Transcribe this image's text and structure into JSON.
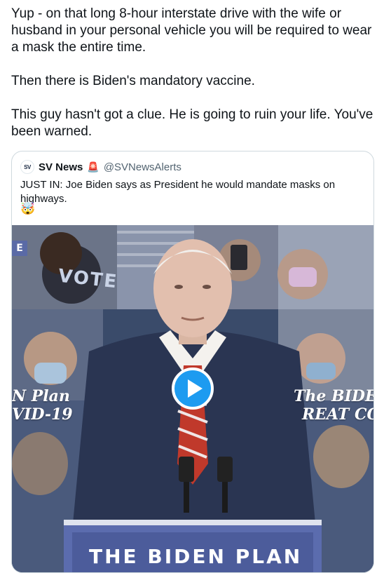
{
  "tweet": {
    "paragraphs": [
      "Yup - on that long 8-hour interstate drive with the wife or husband in your personal vehicle you will be required to wear a mask the entire time.",
      "Then there is Biden's mandatory vaccine.",
      "This guy hasn't got a clue. He is going to ruin your life. You've been warned."
    ]
  },
  "quote": {
    "avatar_text": "SV",
    "name": "SV News",
    "badge_emoji": "🚨",
    "handle": "@SVNewsAlerts",
    "text": "JUST IN: Joe Biden says as President he would mandate masks on highways.",
    "emoji": "🤯",
    "media": {
      "type": "video",
      "overlay_left_lines": [
        "N Plan",
        "VID-19"
      ],
      "overlay_right_lines": [
        "The BIDE",
        "REAT CO"
      ],
      "sign_text": "VOTE",
      "edge_badge": "E",
      "podium_text": "THE BIDEN PLAN",
      "colors": {
        "accent": "#1d9bf0",
        "backdrop": "#3a4b6a",
        "suit": "#2a3552",
        "podium": "#5b6cae"
      }
    }
  }
}
